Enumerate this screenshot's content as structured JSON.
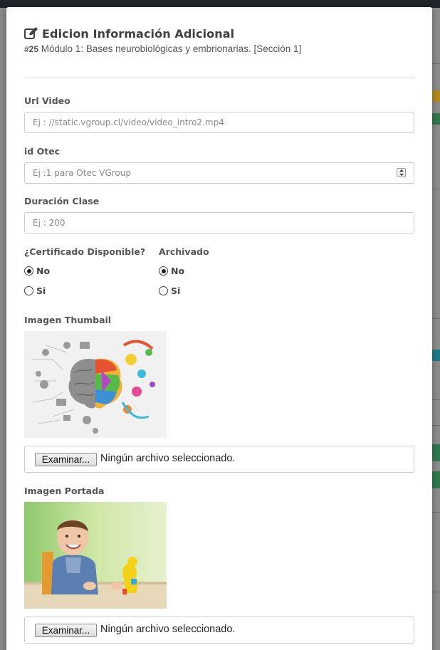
{
  "modal": {
    "title": "Edicion Información Adicional",
    "subtitle_number": "#25",
    "subtitle_text": " Módulo 1: Bases neurobiológicas y embrionarias. [Sección 1]",
    "icon": "edit-icon"
  },
  "form": {
    "url_video": {
      "label": "Url Video",
      "placeholder": "Ej : //static.vgroup.cl/video/video_intro2.mp4"
    },
    "id_otec": {
      "label": "id Otec",
      "placeholder": "Ej :1 para Otec VGroup"
    },
    "duracion": {
      "label": "Duración Clase",
      "placeholder": "Ej : 200"
    },
    "certificado": {
      "label": "¿Certificado Disponible?",
      "options": [
        {
          "label": "No",
          "checked": true
        },
        {
          "label": "Si",
          "checked": false
        }
      ]
    },
    "archivado": {
      "label": "Archivado",
      "options": [
        {
          "label": "No",
          "checked": true
        },
        {
          "label": "Si",
          "checked": false
        }
      ]
    },
    "imagen_thumbail": {
      "label": "Imagen Thumbail",
      "browse_label": "Examinar...",
      "file_status": "Ningún archivo seleccionado."
    },
    "imagen_portada": {
      "label": "Imagen Portada",
      "browse_label": "Examinar...",
      "file_status": "Ningún archivo seleccionado."
    }
  },
  "colors": {
    "overlay": "#8a8a8a",
    "topbar": "#1f252b",
    "text": "#555555",
    "border": "#cccccc"
  }
}
